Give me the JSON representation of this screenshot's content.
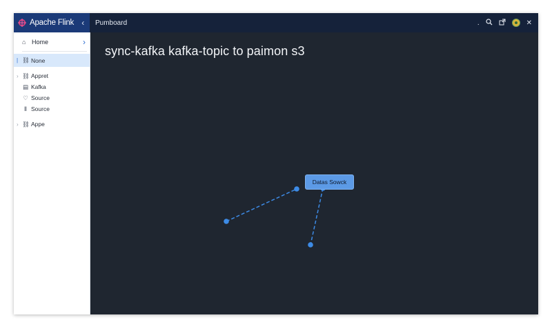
{
  "sidebar": {
    "brand": "Apache Flink",
    "collapse_icon": "chevron-left-icon",
    "home": {
      "label": "Home",
      "icon": "home-icon"
    },
    "items": [
      {
        "label": "None",
        "icon": "link-icon",
        "active": true
      },
      {
        "label": "Appret",
        "icon": "link-icon"
      },
      {
        "label": "Kafka",
        "icon": "table-icon"
      },
      {
        "label": "Source",
        "icon": "shield-icon"
      },
      {
        "label": "Source",
        "icon": "columns-icon"
      },
      {
        "label": "Appe",
        "icon": "link-icon"
      }
    ]
  },
  "header": {
    "title": "Pumboard",
    "dot": ".",
    "icons": [
      "search-icon",
      "external-icon",
      "avatar",
      "close-icon"
    ]
  },
  "main": {
    "title": "sync-kafka kafka-topic to paimon s3",
    "node": {
      "label": "Datas Sowck"
    }
  },
  "colors": {
    "brand_bar": "#1b3a78",
    "header": "#15223a",
    "canvas": "#1f2630",
    "accent": "#5c9ae6",
    "edge": "#3d8be6"
  }
}
